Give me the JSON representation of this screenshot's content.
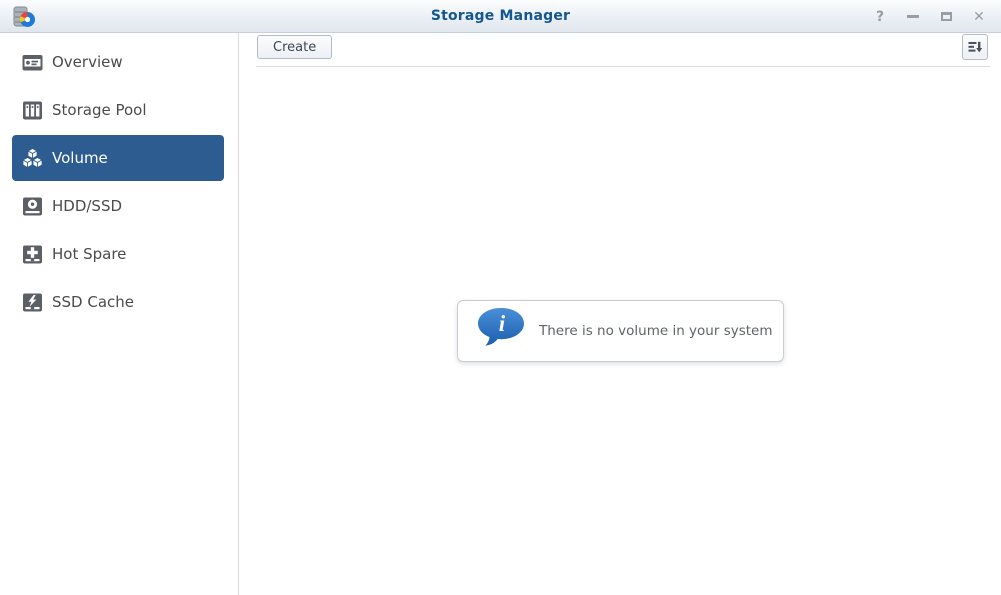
{
  "window": {
    "title": "Storage Manager",
    "controls": {
      "help": "?",
      "minimize": "minimize",
      "maximize": "maximize",
      "close": "✕"
    }
  },
  "sidebar": {
    "items": [
      {
        "label": "Overview",
        "icon": "overview-icon",
        "selected": false
      },
      {
        "label": "Storage Pool",
        "icon": "storage-pool-icon",
        "selected": false
      },
      {
        "label": "Volume",
        "icon": "volume-cubes-icon",
        "selected": true
      },
      {
        "label": "HDD/SSD",
        "icon": "hdd-ssd-icon",
        "selected": false
      },
      {
        "label": "Hot Spare",
        "icon": "hot-spare-icon",
        "selected": false
      },
      {
        "label": "SSD Cache",
        "icon": "ssd-cache-icon",
        "selected": false
      }
    ]
  },
  "toolbar": {
    "create_label": "Create",
    "sort_icon": "sort-descending-icon"
  },
  "main": {
    "empty_message": "There is no volume in your system",
    "info_icon": "info-bubble-icon"
  },
  "colors": {
    "accent_blue": "#2c5c90",
    "title_blue": "#14568f",
    "bubble_blue": "#2377c8",
    "icon_gray": "#5b6066"
  }
}
